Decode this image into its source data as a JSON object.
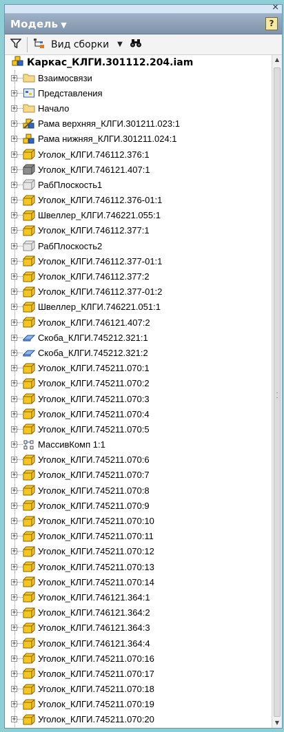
{
  "panel": {
    "title": "Модель",
    "title_caret": "▼",
    "help": "?",
    "close": "×"
  },
  "toolbar": {
    "view_label": "Вид сборки",
    "dropdown": "▼"
  },
  "tree": {
    "root_label": "Каркас_КЛГИ.301112.204.iam",
    "items": [
      {
        "label": "Взаимосвязи",
        "icon": "folder-icon"
      },
      {
        "label": "Представления",
        "icon": "representations-icon"
      },
      {
        "label": "Начало",
        "icon": "folder-icon"
      },
      {
        "label": "Рама верхняя_КЛГИ.301211.023:1",
        "icon": "subassembly-edit-icon"
      },
      {
        "label": "Рама нижняя_КЛГИ.301211.024:1",
        "icon": "subassembly-icon"
      },
      {
        "label": "Уголок_КЛГИ.746112.376:1",
        "icon": "part-icon"
      },
      {
        "label": "Уголок_КЛГИ.746121.407:1",
        "icon": "part-gray-icon"
      },
      {
        "label": "РабПлоскость1",
        "icon": "work-plane-icon"
      },
      {
        "label": "Уголок_КЛГИ.746112.376-01:1",
        "icon": "part-icon"
      },
      {
        "label": "Швеллер_КЛГИ.746221.055:1",
        "icon": "part-icon"
      },
      {
        "label": "Уголок_КЛГИ.746112.377:1",
        "icon": "part-icon"
      },
      {
        "label": "РабПлоскость2",
        "icon": "work-plane-icon"
      },
      {
        "label": "Уголок_КЛГИ.746112.377-01:1",
        "icon": "part-icon"
      },
      {
        "label": "Уголок_КЛГИ.746112.377:2",
        "icon": "part-icon"
      },
      {
        "label": "Уголок_КЛГИ.746112.377-01:2",
        "icon": "part-icon"
      },
      {
        "label": "Швеллер_КЛГИ.746221.051:1",
        "icon": "part-icon"
      },
      {
        "label": "Уголок_КЛГИ.746121.407:2",
        "icon": "part-icon"
      },
      {
        "label": "Скоба_КЛГИ.745212.321:1",
        "icon": "sheet-metal-icon"
      },
      {
        "label": "Скоба_КЛГИ.745212.321:2",
        "icon": "sheet-metal-icon"
      },
      {
        "label": "Уголок_КЛГИ.745211.070:1",
        "icon": "part-icon"
      },
      {
        "label": "Уголок_КЛГИ.745211.070:2",
        "icon": "part-icon"
      },
      {
        "label": "Уголок_КЛГИ.745211.070:3",
        "icon": "part-icon"
      },
      {
        "label": "Уголок_КЛГИ.745211.070:4",
        "icon": "part-icon"
      },
      {
        "label": "Уголок_КЛГИ.745211.070:5",
        "icon": "part-icon"
      },
      {
        "label": "МассивКомп 1:1",
        "icon": "pattern-icon"
      },
      {
        "label": "Уголок_КЛГИ.745211.070:6",
        "icon": "part-icon"
      },
      {
        "label": "Уголок_КЛГИ.745211.070:7",
        "icon": "part-icon"
      },
      {
        "label": "Уголок_КЛГИ.745211.070:8",
        "icon": "part-icon"
      },
      {
        "label": "Уголок_КЛГИ.745211.070:9",
        "icon": "part-icon"
      },
      {
        "label": "Уголок_КЛГИ.745211.070:10",
        "icon": "part-icon"
      },
      {
        "label": "Уголок_КЛГИ.745211.070:11",
        "icon": "part-icon"
      },
      {
        "label": "Уголок_КЛГИ.745211.070:12",
        "icon": "part-icon"
      },
      {
        "label": "Уголок_КЛГИ.745211.070:13",
        "icon": "part-icon"
      },
      {
        "label": "Уголок_КЛГИ.745211.070:14",
        "icon": "part-icon"
      },
      {
        "label": "Уголок_КЛГИ.746121.364:1",
        "icon": "part-icon"
      },
      {
        "label": "Уголок_КЛГИ.746121.364:2",
        "icon": "part-icon"
      },
      {
        "label": "Уголок_КЛГИ.746121.364:3",
        "icon": "part-icon"
      },
      {
        "label": "Уголок_КЛГИ.746121.364:4",
        "icon": "part-icon"
      },
      {
        "label": "Уголок_КЛГИ.745211.070:16",
        "icon": "part-icon"
      },
      {
        "label": "Уголок_КЛГИ.745211.070:17",
        "icon": "part-icon"
      },
      {
        "label": "Уголок_КЛГИ.745211.070:18",
        "icon": "part-icon"
      },
      {
        "label": "Уголок_КЛГИ.745211.070:19",
        "icon": "part-icon"
      },
      {
        "label": "Уголок_КЛГИ.745211.070:20",
        "icon": "part-icon"
      }
    ]
  },
  "colors": {
    "part": "#f3c623",
    "folder": "#f6d98a",
    "title_bar": "#8fa3ba",
    "background": "#8ecfd6"
  }
}
